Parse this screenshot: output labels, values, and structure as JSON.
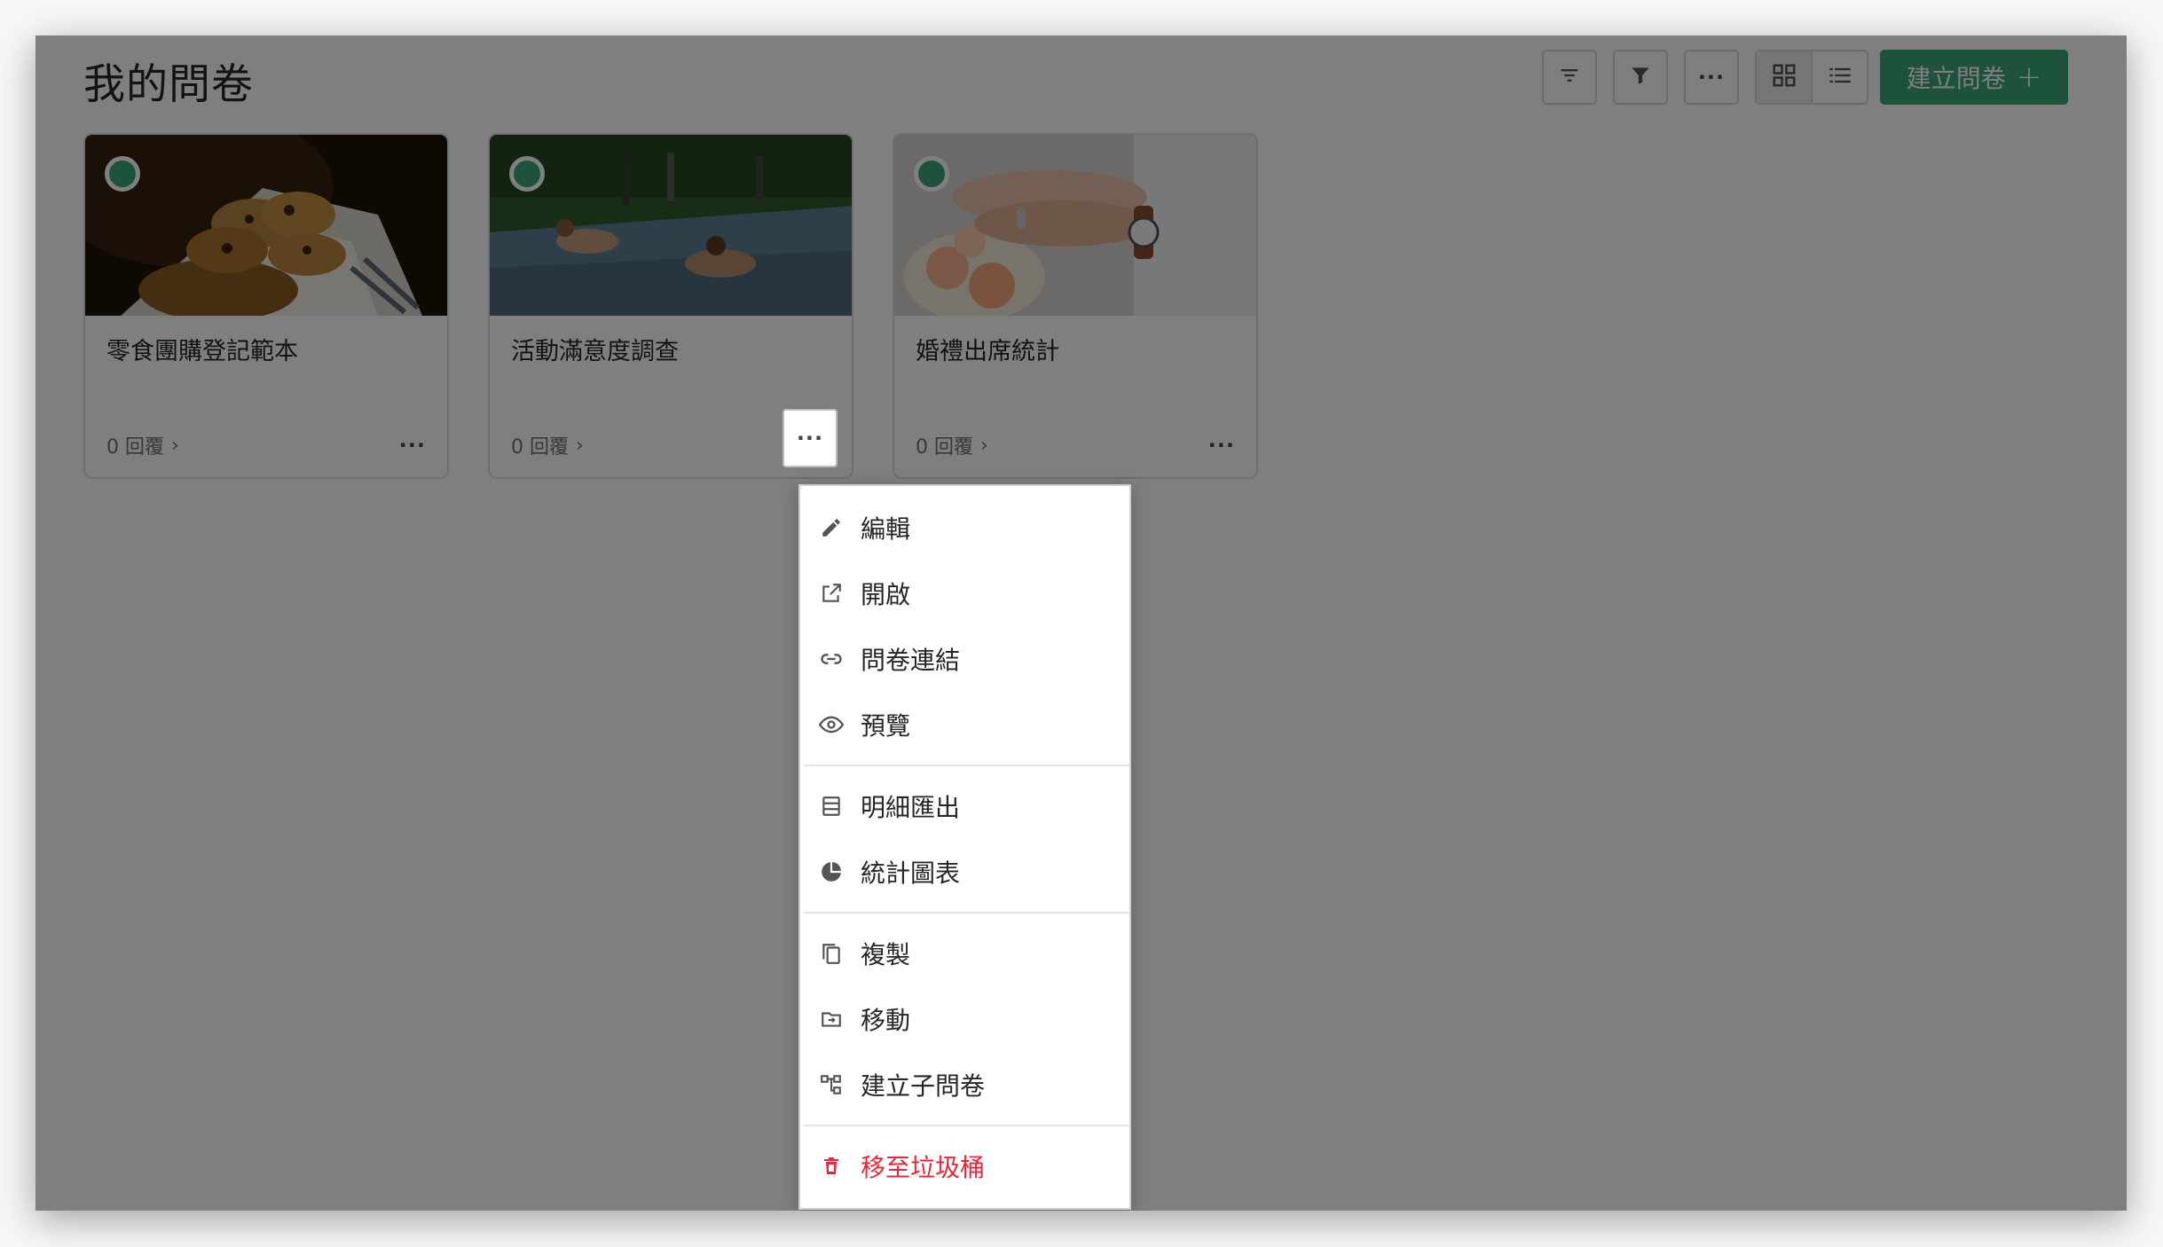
{
  "page": {
    "title": "我的問卷"
  },
  "toolbar": {
    "sort_icon": "sort-icon",
    "filter_icon": "filter-icon",
    "more_icon": "more-horizontal-icon",
    "grid_icon": "grid-view-icon",
    "list_icon": "list-view-icon",
    "create_label": "建立問卷",
    "create_plus": "+"
  },
  "cards": [
    {
      "title": "零食團購登記範本",
      "replies": "0 回覆",
      "chevron": "›",
      "more": "···",
      "status": "active"
    },
    {
      "title": "活動滿意度調查",
      "replies": "0 回覆",
      "chevron": "›",
      "more": "···",
      "status": "active"
    },
    {
      "title": "婚禮出席統計",
      "replies": "0 回覆",
      "chevron": "›",
      "more": "···",
      "status": "active"
    }
  ],
  "context_menu": {
    "items": [
      {
        "label": "編輯",
        "icon": "pencil-icon"
      },
      {
        "label": "開啟",
        "icon": "open-external-icon"
      },
      {
        "label": "問卷連結",
        "icon": "link-icon"
      },
      {
        "label": "預覽",
        "icon": "eye-icon"
      },
      {
        "label": "明細匯出",
        "icon": "table-export-icon"
      },
      {
        "label": "統計圖表",
        "icon": "pie-chart-icon"
      },
      {
        "label": "複製",
        "icon": "copy-icon"
      },
      {
        "label": "移動",
        "icon": "move-folder-icon"
      },
      {
        "label": "建立子問卷",
        "icon": "sub-survey-icon"
      },
      {
        "label": "移至垃圾桶",
        "icon": "trash-icon"
      }
    ]
  },
  "colors": {
    "accent": "#3aa577",
    "danger": "#e8283a",
    "overlay": "rgba(0,0,0,0.5)"
  }
}
